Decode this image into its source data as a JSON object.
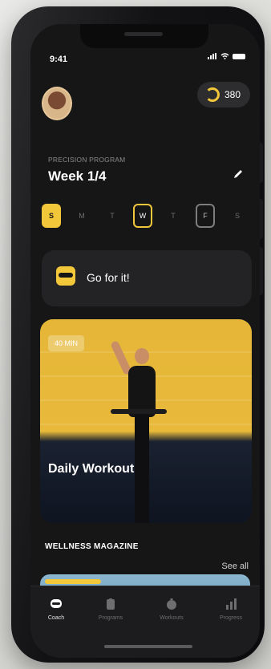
{
  "status_bar": {
    "time": "9:41"
  },
  "header": {
    "coins": "380"
  },
  "program": {
    "label": "PRECISION PROGRAM",
    "week": "Week 1/4"
  },
  "days": [
    "S",
    "M",
    "T",
    "W",
    "T",
    "F",
    "S"
  ],
  "motivation": {
    "text": "Go for it!"
  },
  "workout": {
    "duration": "40 MIN",
    "title": "Daily Workout"
  },
  "magazine": {
    "header": "WELLNESS MAGAZINE",
    "see_all": "See all"
  },
  "tabs": [
    {
      "label": "Coach",
      "icon": "coach-icon"
    },
    {
      "label": "Programs",
      "icon": "clipboard-icon"
    },
    {
      "label": "Workouts",
      "icon": "stopwatch-icon"
    },
    {
      "label": "Progress",
      "icon": "bar-chart-icon"
    }
  ],
  "colors": {
    "accent": "#f2c83a",
    "background": "#161617",
    "card": "#232325"
  }
}
